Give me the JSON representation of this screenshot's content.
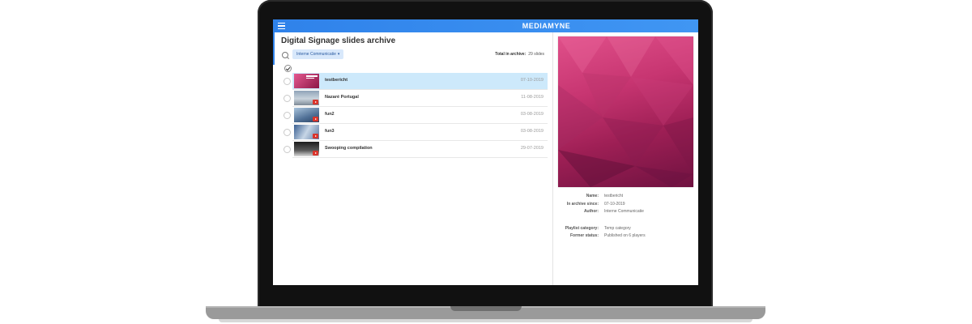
{
  "header": {
    "brand": "MEDIAMYNE"
  },
  "archive": {
    "title": "Digital Signage slides archive",
    "filter_value": "Interne Communicatie",
    "total_label": "Total in archive:",
    "total_value": "29 slides"
  },
  "slides": [
    {
      "name": "testbericht",
      "date": "07-10-2019",
      "selected": true,
      "video": false
    },
    {
      "name": "Nazaré Portugal",
      "date": "11-08-2019",
      "selected": false,
      "video": true
    },
    {
      "name": "fun2",
      "date": "03-08-2019",
      "selected": false,
      "video": true
    },
    {
      "name": "fun3",
      "date": "03-08-2019",
      "selected": false,
      "video": true
    },
    {
      "name": "Swooping compilation",
      "date": "29-07-2019",
      "selected": false,
      "video": true
    }
  ],
  "details": {
    "name_label": "Name:",
    "name_value": "testbericht",
    "since_label": "In archive since:",
    "since_value": "07-10-2019",
    "author_label": "Author:",
    "author_value": "Interne Communicatie",
    "category_label": "Playlist category:",
    "category_value": "Temp category",
    "status_label": "Former status:",
    "status_value": "Published on 6 players"
  },
  "icons": {
    "menu": "hamburger-icon",
    "search": "search-icon",
    "caret": "chevron-down-icon",
    "check": "check-icon",
    "play": "play-icon"
  },
  "colors": {
    "header": "#2f82ea",
    "selected_row": "#cde9fb",
    "play_badge": "#d9342b"
  }
}
